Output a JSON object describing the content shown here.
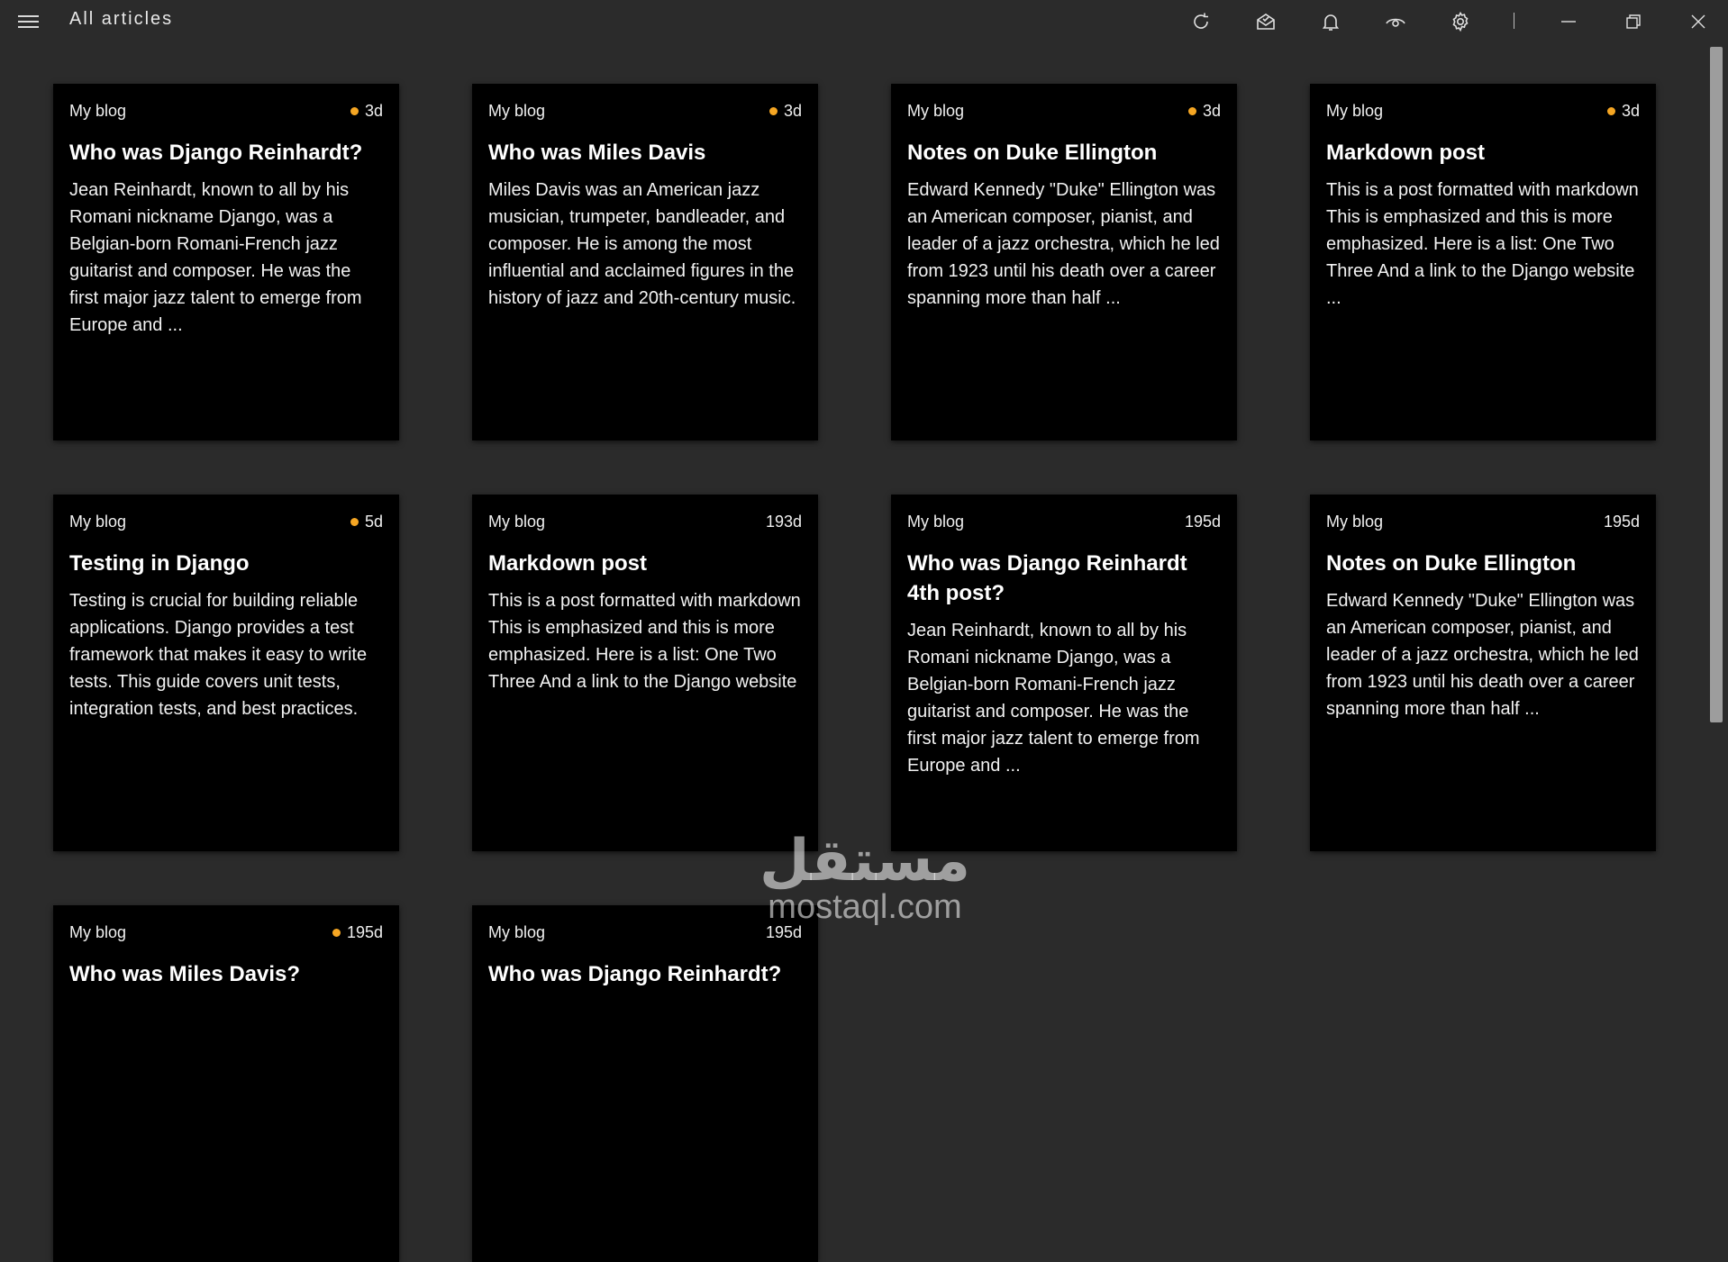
{
  "window": {
    "title": "All articles",
    "icons": [
      "menu-icon",
      "refresh-icon",
      "mark-read-icon",
      "notification-icon",
      "view-icon",
      "settings-icon",
      "minimize-icon",
      "restore-icon",
      "close-icon"
    ]
  },
  "colors": {
    "background": "#2b2b2b",
    "card": "#000000",
    "unread_dot": "#f5a623"
  },
  "articles": [
    {
      "source": "My blog",
      "age": "3d",
      "unread": true,
      "title": "Who was Django Reinhardt?",
      "excerpt": "Jean Reinhardt, known to all by his Romani nickname Django, was a Belgian-born Romani-French jazz guitarist and composer. He was the first major jazz talent to emerge from Europe and ..."
    },
    {
      "source": "My blog",
      "age": "3d",
      "unread": true,
      "title": "Who was Miles Davis",
      "excerpt": "Miles Davis was an American jazz musician, trumpeter, bandleader, and composer. He is among the most influential and acclaimed figures in the history of jazz and 20th-century music."
    },
    {
      "source": "My blog",
      "age": "3d",
      "unread": true,
      "title": "Notes on Duke Ellington",
      "excerpt": "Edward Kennedy \"Duke\" Ellington was an American composer, pianist, and leader of a jazz orchestra, which he led from 1923 until his death over a career spanning more than half ..."
    },
    {
      "source": "My blog",
      "age": "3d",
      "unread": true,
      "title": "Markdown post",
      "excerpt": "This is a post formatted with markdown This is emphasized and this is more emphasized. Here is a list: One Two Three And a link to the Django website ..."
    },
    {
      "source": "My blog",
      "age": "5d",
      "unread": true,
      "title": "Testing in Django",
      "excerpt": "Testing is crucial for building reliable applications. Django provides a test framework that makes it easy to write tests. This guide covers unit tests, integration tests, and best practices."
    },
    {
      "source": "My blog",
      "age": "193d",
      "unread": false,
      "title": "Markdown post",
      "excerpt": "This is a post formatted with markdown This is emphasized and this is more emphasized. Here is a list: One Two Three And a link to the Django website"
    },
    {
      "source": "My blog",
      "age": "195d",
      "unread": false,
      "title": "Who was Django Reinhardt 4th post?",
      "excerpt": "Jean Reinhardt, known to all by his Romani nickname Django, was a Belgian-born Romani-French jazz guitarist and composer. He was the first major jazz talent to emerge from Europe and ..."
    },
    {
      "source": "My blog",
      "age": "195d",
      "unread": false,
      "title": "Notes on Duke Ellington",
      "excerpt": "Edward Kennedy \"Duke\" Ellington was an American composer, pianist, and leader of a jazz orchestra, which he led from 1923 until his death over a career spanning more than half ..."
    },
    {
      "source": "My blog",
      "age": "195d",
      "unread": true,
      "title": "Who was Miles Davis?",
      "excerpt": ""
    },
    {
      "source": "My blog",
      "age": "195d",
      "unread": false,
      "title": "Who was Django Reinhardt?",
      "excerpt": ""
    }
  ],
  "watermark": {
    "logo": "مستقل",
    "text": "mostaql.com"
  }
}
